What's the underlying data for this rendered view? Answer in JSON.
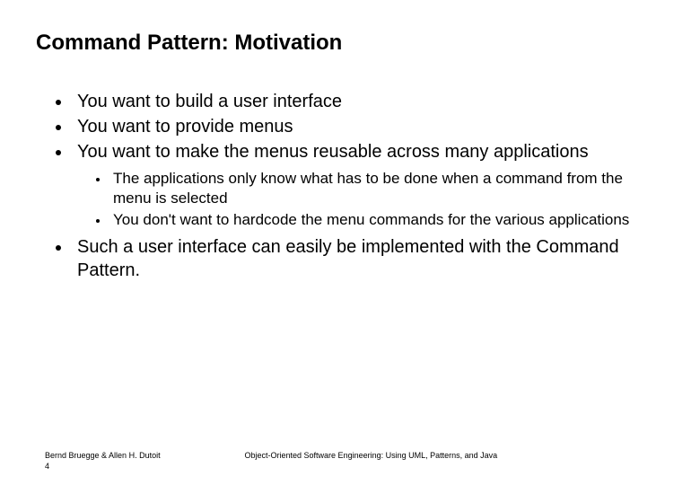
{
  "title": "Command Pattern: Motivation",
  "bullets": {
    "b0": "You want  to build a user interface",
    "b1": "You want to provide menus",
    "b2": "You want to make the menus reusable across many applications",
    "sub0": "The applications only know what has to be done when a command from the menu is selected",
    "sub1": "You don't want to hardcode the menu commands for the various applications",
    "b3": "Such a user interface can easily be implemented with the Command Pattern."
  },
  "footer": {
    "authors": "Bernd Bruegge & Allen H. Dutoit",
    "book": "Object-Oriented Software Engineering: Using UML, Patterns, and Java",
    "page": "4"
  }
}
